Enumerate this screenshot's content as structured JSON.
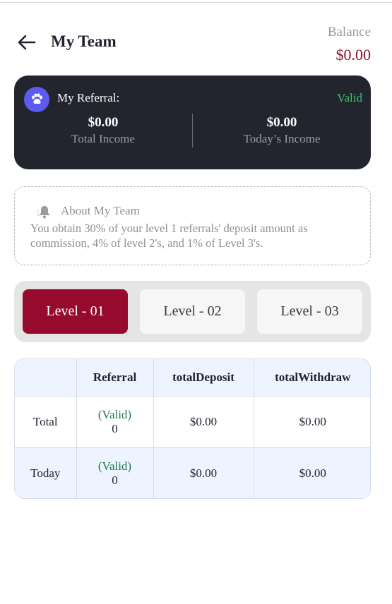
{
  "header": {
    "title": "My Team",
    "balance_label": "Balance",
    "balance_value": "$0.00"
  },
  "referral_card": {
    "title": "My Referral:",
    "status": "Valid",
    "total_income_amount": "$0.00",
    "total_income_label": "Total Income",
    "today_income_amount": "$0.00",
    "today_income_label": "Today’s Income"
  },
  "about": {
    "title": "About My Team",
    "text": "You obtain 30% of your level 1 referrals' deposit amount as commission, 4% of level 2's, and 1% of Level 3's."
  },
  "levels": {
    "items": [
      "Level - 01",
      "Level - 02",
      "Level - 03"
    ],
    "active": "Level - 01"
  },
  "table": {
    "headers": [
      "",
      "Referral",
      "totalDeposit",
      "totalWithdraw"
    ],
    "rows": [
      {
        "label": "Total",
        "valid": "(Valid)",
        "count": "0",
        "deposit": "$0.00",
        "withdraw": "$0.00"
      },
      {
        "label": "Today",
        "valid": "(Valid)",
        "count": "0",
        "deposit": "$0.00",
        "withdraw": "$0.00"
      }
    ]
  },
  "colors": {
    "accent": "#960a2d",
    "card_bg": "#22242e",
    "valid_green": "#36c96a",
    "icon_purple": "#5b5bf0"
  },
  "icons": {
    "back": "arrow-left-icon",
    "referral": "paw-icon",
    "about": "bell-icon"
  }
}
